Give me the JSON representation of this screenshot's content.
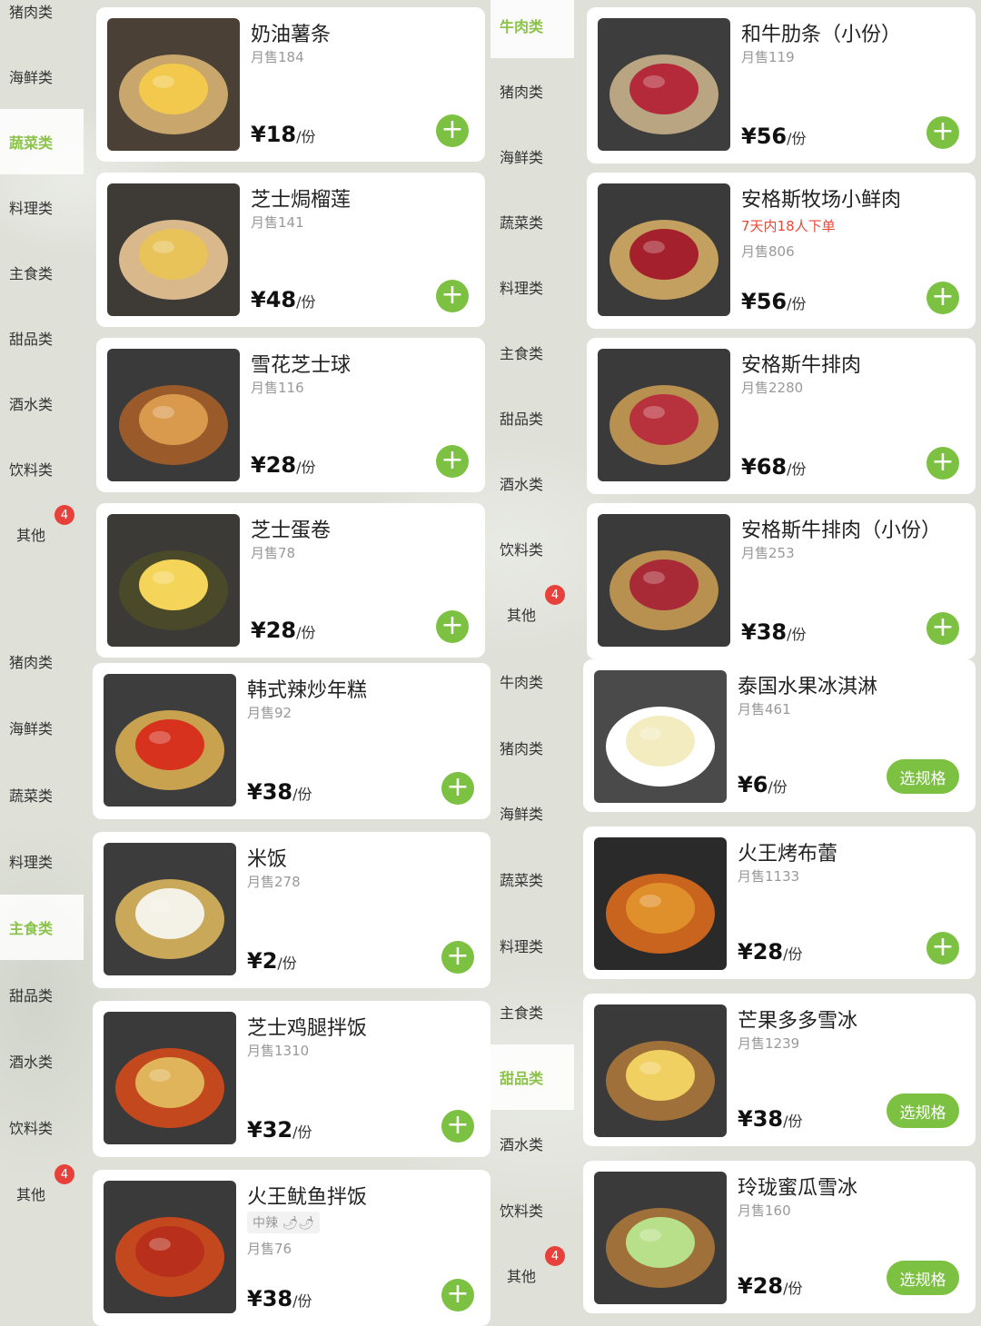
{
  "colors": {
    "accent": "#7cc142",
    "badge": "#e8403a",
    "promo": "#e84a3a"
  },
  "panels": [
    {
      "sidebar": [
        {
          "label": "猪肉类",
          "active": false
        },
        {
          "label": "海鲜类",
          "active": false
        },
        {
          "label": "蔬菜类",
          "active": true
        },
        {
          "label": "料理类",
          "active": false
        },
        {
          "label": "主食类",
          "active": false
        },
        {
          "label": "甜品类",
          "active": false
        },
        {
          "label": "酒水类",
          "active": false
        },
        {
          "label": "饮料类",
          "active": false
        },
        {
          "label": "其他",
          "active": false,
          "badge": "4"
        }
      ],
      "items": [
        {
          "name": "奶油薯条",
          "sales": "月售184",
          "price": "¥18",
          "unit": "/份",
          "action": "add",
          "image": "fries"
        },
        {
          "name": "芝士焗榴莲",
          "sales": "月售141",
          "price": "¥48",
          "unit": "/份",
          "action": "add",
          "image": "durian"
        },
        {
          "name": "雪花芝士球",
          "sales": "月售116",
          "price": "¥28",
          "unit": "/份",
          "action": "add",
          "image": "cheeseball"
        },
        {
          "name": "芝士蛋卷",
          "sales": "月售78",
          "price": "¥28",
          "unit": "/份",
          "action": "add",
          "image": "eggroll"
        }
      ]
    },
    {
      "sidebar": [
        {
          "label": "牛肉类",
          "active": true
        },
        {
          "label": "猪肉类",
          "active": false
        },
        {
          "label": "海鲜类",
          "active": false
        },
        {
          "label": "蔬菜类",
          "active": false
        },
        {
          "label": "料理类",
          "active": false
        },
        {
          "label": "主食类",
          "active": false
        },
        {
          "label": "甜品类",
          "active": false
        },
        {
          "label": "酒水类",
          "active": false
        },
        {
          "label": "饮料类",
          "active": false
        },
        {
          "label": "其他",
          "active": false,
          "badge": "4"
        }
      ],
      "items": [
        {
          "name": "和牛肋条（小份）",
          "sales": "月售119",
          "price": "¥56",
          "unit": "/份",
          "action": "add",
          "image": "beef"
        },
        {
          "name": "安格斯牧场小鲜肉",
          "promo": "7天内18人下单",
          "sales": "月售806",
          "price": "¥56",
          "unit": "/份",
          "action": "add",
          "image": "beef2"
        },
        {
          "name": "安格斯牛排肉",
          "sales": "月售2280",
          "price": "¥68",
          "unit": "/份",
          "action": "add",
          "image": "steak"
        },
        {
          "name": "安格斯牛排肉（小份）",
          "sales": "月售253",
          "price": "¥38",
          "unit": "/份",
          "action": "add",
          "image": "steak2"
        }
      ]
    },
    {
      "sidebar": [
        {
          "label": "猪肉类",
          "active": false
        },
        {
          "label": "海鲜类",
          "active": false
        },
        {
          "label": "蔬菜类",
          "active": false
        },
        {
          "label": "料理类",
          "active": false
        },
        {
          "label": "主食类",
          "active": true
        },
        {
          "label": "甜品类",
          "active": false
        },
        {
          "label": "酒水类",
          "active": false
        },
        {
          "label": "饮料类",
          "active": false
        },
        {
          "label": "其他",
          "active": false,
          "badge": "4"
        }
      ],
      "items": [
        {
          "name": "韩式辣炒年糕",
          "sales": "月售92",
          "price": "¥38",
          "unit": "/份",
          "action": "add",
          "image": "ricecake"
        },
        {
          "name": "米饭",
          "sales": "月售278",
          "price": "¥2",
          "unit": "/份",
          "action": "add",
          "image": "rice"
        },
        {
          "name": "芝士鸡腿拌饭",
          "sales": "月售1310",
          "price": "¥32",
          "unit": "/份",
          "action": "add",
          "image": "chicken"
        },
        {
          "name": "火王鱿鱼拌饭",
          "spicy": "中辣 🌶🌶",
          "sales": "月售76",
          "price": "¥38",
          "unit": "/份",
          "action": "add",
          "image": "squid"
        }
      ]
    },
    {
      "sidebar": [
        {
          "label": "牛肉类",
          "active": false
        },
        {
          "label": "猪肉类",
          "active": false
        },
        {
          "label": "海鲜类",
          "active": false
        },
        {
          "label": "蔬菜类",
          "active": false
        },
        {
          "label": "料理类",
          "active": false
        },
        {
          "label": "主食类",
          "active": false
        },
        {
          "label": "甜品类",
          "active": true
        },
        {
          "label": "酒水类",
          "active": false
        },
        {
          "label": "饮料类",
          "active": false
        },
        {
          "label": "其他",
          "active": false,
          "badge": "4"
        }
      ],
      "items": [
        {
          "name": "泰国水果冰淇淋",
          "sales": "月售461",
          "price": "¥6",
          "unit": "/份",
          "action": "spec",
          "action_label": "选规格",
          "image": "icecream"
        },
        {
          "name": "火王烤布蕾",
          "sales": "月售1133",
          "price": "¥28",
          "unit": "/份",
          "action": "add",
          "image": "brulee"
        },
        {
          "name": "芒果多多雪冰",
          "sales": "月售1239",
          "price": "¥38",
          "unit": "/份",
          "action": "spec",
          "action_label": "选规格",
          "image": "mango"
        },
        {
          "name": "玲珑蜜瓜雪冰",
          "sales": "月售160",
          "price": "¥28",
          "unit": "/份",
          "action": "spec",
          "action_label": "选规格",
          "image": "melon"
        }
      ]
    }
  ]
}
